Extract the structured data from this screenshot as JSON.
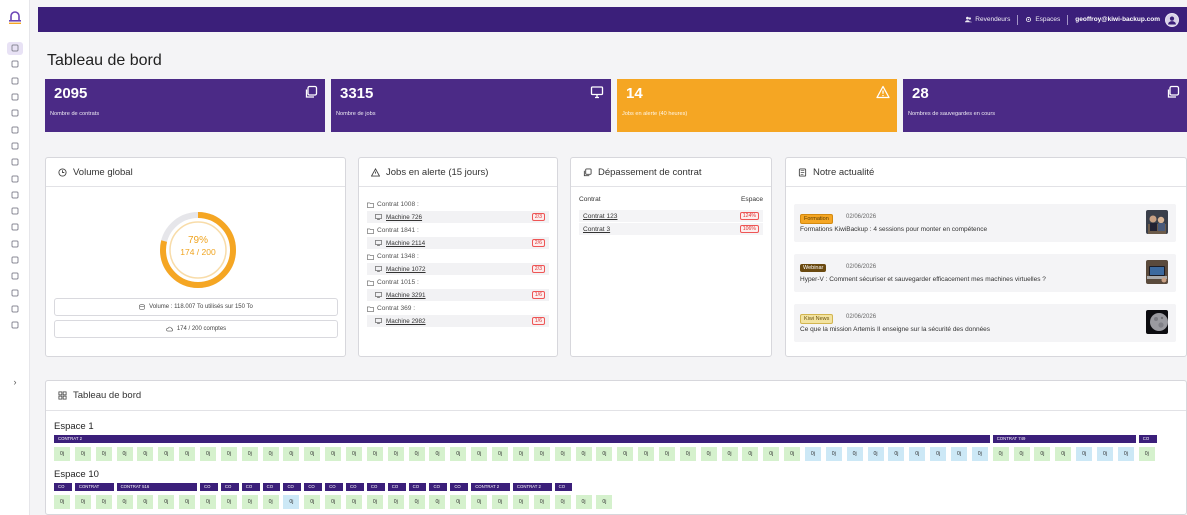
{
  "topbar": {
    "resellers": "Revendeurs",
    "spaces": "Espaces",
    "email": "geoffroy@kiwi-backup.com"
  },
  "page_title": "Tableau de bord",
  "stats": [
    {
      "value": "2095",
      "label": "Nombre de contrats",
      "color": "#4b2a86"
    },
    {
      "value": "3315",
      "label": "Nombre de jobs",
      "color": "#4b2a86"
    },
    {
      "value": "14",
      "label": "Jobs en alerte (40 heures)",
      "color": "#f5a623"
    },
    {
      "value": "28",
      "label": "Nombres de sauvegardes en cours",
      "color": "#4b2a86"
    }
  ],
  "volume": {
    "title": "Volume global",
    "percent_text": "79%",
    "count_text": "174 / 200",
    "percent": 0.79,
    "volume_line": "Volume : 118.007 To utilisés sur 150 To",
    "accounts_line": "174 / 200 comptes"
  },
  "alerts": {
    "title": "Jobs en alerte (15 jours)",
    "items": [
      {
        "contract": "Contrat 1008 :",
        "machine": "Machine 726",
        "badge": "2/3"
      },
      {
        "contract": "Contrat 1841 :",
        "machine": "Machine 2114",
        "badge": "2/6"
      },
      {
        "contract": "Contrat 1348 :",
        "machine": "Machine 1072",
        "badge": "2/3"
      },
      {
        "contract": "Contrat 1015 :",
        "machine": "Machine 3291",
        "badge": "1/6"
      },
      {
        "contract": "Contrat 369 :",
        "machine": "Machine 2982",
        "badge": "1/6"
      }
    ]
  },
  "overrun": {
    "title": "Dépassement de contrat",
    "col_contract": "Contrat",
    "col_space": "Espace",
    "rows": [
      {
        "contract": "Contrat 123",
        "pct": "124%"
      },
      {
        "contract": "Contrat 3",
        "pct": "106%"
      }
    ]
  },
  "news": {
    "title": "Notre actualité",
    "items": [
      {
        "tag": "Formation",
        "tag_color": "#f5a623",
        "date": "02/06/2026",
        "title": "Formations KiwiBackup : 4 sessions pour monter en compétence"
      },
      {
        "tag": "Webinar",
        "tag_color": "#6b4a10",
        "date": "02/06/2026",
        "title": "Hyper-V : Comment sécuriser et sauvegarder efficacement mes machines virtuelles ?"
      },
      {
        "tag": "Kiwi News",
        "tag_color": "#f3e3a0",
        "date": "02/06/2026",
        "title": "Ce que la mission Artemis II enseigne sur la sécurité des données"
      }
    ]
  },
  "dashboard": {
    "title": "Tableau de bord",
    "spaces": [
      {
        "name": "Espace 1",
        "contracts": [
          {
            "label": "CONTRAT 2",
            "slots": 45
          },
          {
            "label": "CONTRAT 749",
            "slots": 7
          },
          {
            "label": "CO",
            "slots": 1
          }
        ],
        "cells": [
          "0j",
          "0j",
          "0j",
          "0j",
          "0j",
          "0j",
          "0j",
          "0j",
          "0j",
          "0j",
          "0j",
          "0j",
          "0j",
          "0j",
          "0j",
          "0j",
          "0j",
          "0j",
          "0j",
          "0j",
          "0j",
          "0j",
          "0j",
          "0j",
          "0j",
          "0j",
          "0j",
          "0j",
          "0j",
          "0j",
          "0j",
          "0j",
          "0j",
          "0j",
          "0j",
          "0j",
          "0j",
          "0j",
          "0j",
          "0j",
          "0j",
          "0j",
          "0j",
          "0j",
          "0j",
          "0j",
          "0j",
          "0j",
          "0j",
          "0j",
          "0j",
          "0j",
          "0j"
        ],
        "cell_colors": [
          "g",
          "g",
          "g",
          "g",
          "g",
          "g",
          "g",
          "g",
          "g",
          "g",
          "g",
          "g",
          "g",
          "g",
          "g",
          "g",
          "g",
          "g",
          "g",
          "g",
          "g",
          "g",
          "g",
          "g",
          "g",
          "g",
          "g",
          "g",
          "g",
          "g",
          "g",
          "g",
          "g",
          "g",
          "g",
          "g",
          "b",
          "b",
          "b",
          "b",
          "b",
          "b",
          "b",
          "b",
          "b",
          "g",
          "g",
          "g",
          "g",
          "b",
          "b",
          "b",
          "g"
        ]
      },
      {
        "name": "Espace 10",
        "contracts": [
          {
            "label": "CO",
            "slots": 1
          },
          {
            "label": "CONTRAT",
            "slots": 2
          },
          {
            "label": "CONTRAT 516",
            "slots": 4
          },
          {
            "label": "CO",
            "slots": 1
          },
          {
            "label": "CO",
            "slots": 1
          },
          {
            "label": "CO",
            "slots": 1
          },
          {
            "label": "CO",
            "slots": 1
          },
          {
            "label": "CO",
            "slots": 1
          },
          {
            "label": "CO",
            "slots": 1
          },
          {
            "label": "CO",
            "slots": 1
          },
          {
            "label": "CO",
            "slots": 1
          },
          {
            "label": "CO",
            "slots": 1
          },
          {
            "label": "CO",
            "slots": 1
          },
          {
            "label": "CO",
            "slots": 1
          },
          {
            "label": "CO",
            "slots": 1
          },
          {
            "label": "CO",
            "slots": 1
          },
          {
            "label": "CONTRAT 2",
            "slots": 2
          },
          {
            "label": "CONTRAT 2",
            "slots": 2
          },
          {
            "label": "CO",
            "slots": 1
          }
        ],
        "cells": [
          "0j",
          "0j",
          "0j",
          "0j",
          "0j",
          "0j",
          "0j",
          "0j",
          "0j",
          "0j",
          "0j",
          "0j",
          "0j",
          "0j",
          "0j",
          "0j",
          "0j",
          "0j",
          "0j",
          "0j",
          "0j",
          "0j",
          "0j",
          "0j",
          "0j",
          "0j",
          "0j"
        ],
        "cell_colors": [
          "g",
          "g",
          "g",
          "g",
          "g",
          "g",
          "g",
          "g",
          "g",
          "g",
          "g",
          "b",
          "g",
          "g",
          "g",
          "g",
          "g",
          "g",
          "g",
          "g",
          "g",
          "g",
          "g",
          "g",
          "g",
          "g",
          "g"
        ]
      }
    ]
  }
}
